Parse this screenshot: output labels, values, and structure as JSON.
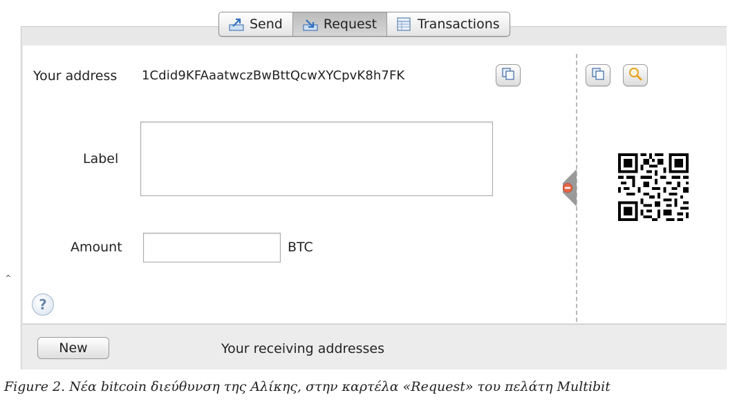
{
  "tabs": [
    {
      "label": "Send",
      "icon": "send-icon"
    },
    {
      "label": "Request",
      "icon": "request-icon",
      "active": true
    },
    {
      "label": "Transactions",
      "icon": "transactions-icon"
    }
  ],
  "request": {
    "your_address_label": "Your address",
    "address": "1Cdid9KFAaatwczBwBttQcwXYCpvK8h7FK",
    "label_label": "Label",
    "label_value": "",
    "amount_label": "Amount",
    "amount_value": "",
    "unit": "BTC"
  },
  "bottom": {
    "new_button": "New",
    "receiving_addresses_title": "Your receiving addresses"
  },
  "caption": "Figure 2. Νέα bitcoin διεύθυνση της Αλίκης, στην καρτέλα «Request» του πελάτη Multibit",
  "colors": {
    "panel_bg": "#e8e8e8",
    "active_tab": "#c4c4c4",
    "collapse_icon": "#e8694a",
    "zoom_icon": "#e8a020"
  }
}
